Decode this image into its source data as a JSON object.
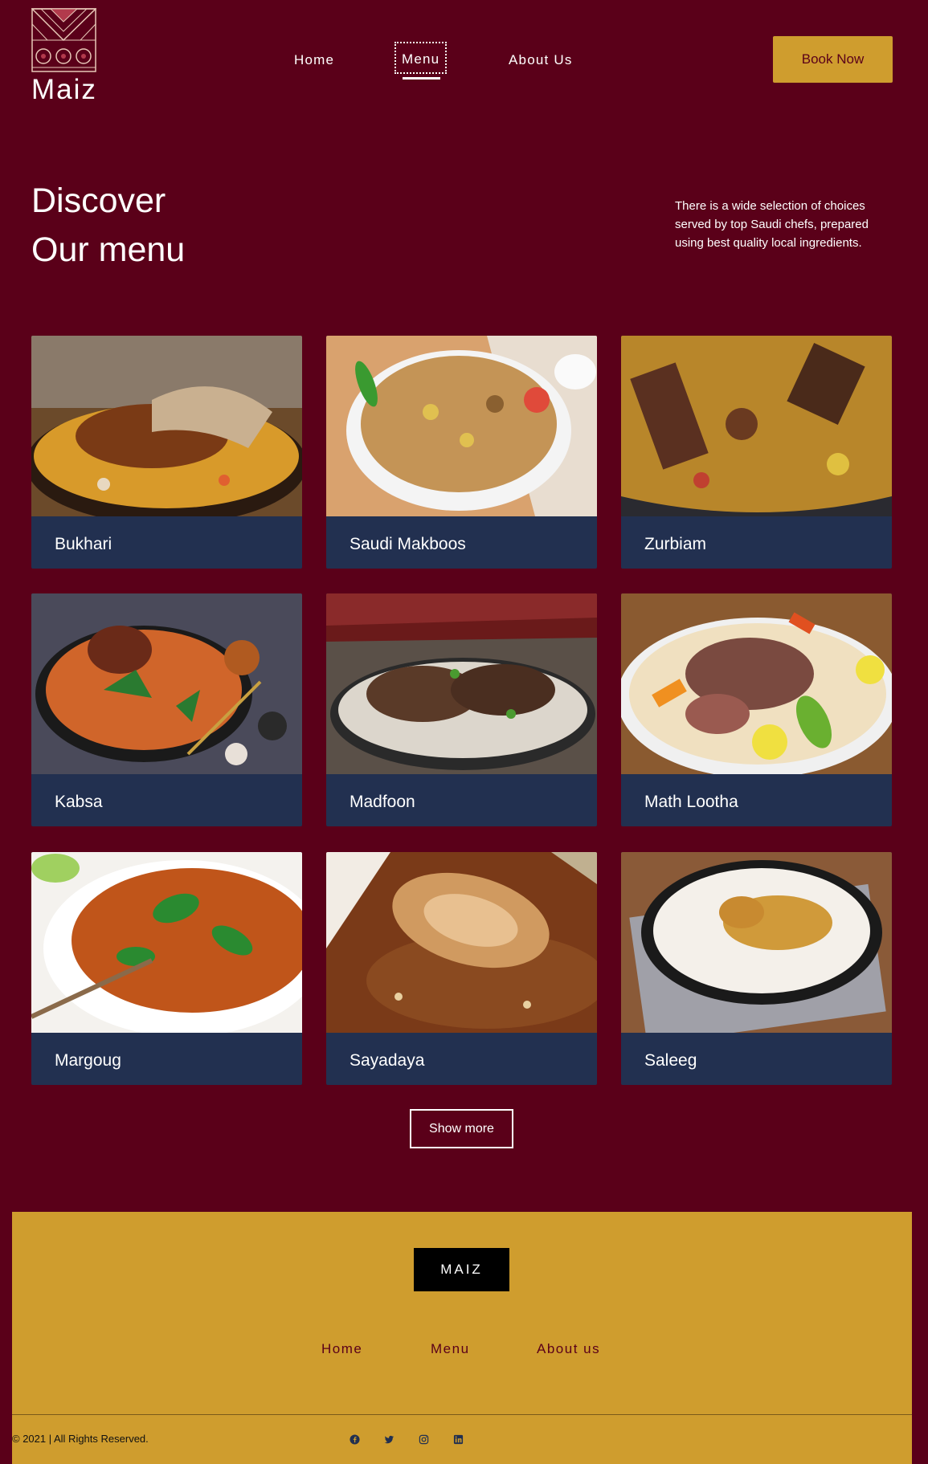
{
  "brand": {
    "name": "Maiz"
  },
  "nav": {
    "home": "Home",
    "menu": "Menu",
    "about": "About Us",
    "book": "Book Now"
  },
  "intro": {
    "title_line1": "Discover",
    "title_line2": "Our menu",
    "text": "There is a wide selection of choices served by top Saudi chefs, prepared using best quality local ingredients."
  },
  "menu": {
    "items": [
      {
        "name": "Bukhari"
      },
      {
        "name": "Saudi Makboos"
      },
      {
        "name": "Zurbiam"
      },
      {
        "name": "Kabsa"
      },
      {
        "name": "Madfoon"
      },
      {
        "name": "Math Lootha"
      },
      {
        "name": "Margoug"
      },
      {
        "name": "Sayadaya"
      },
      {
        "name": "Saleeg"
      }
    ],
    "show_more": "Show more"
  },
  "footer": {
    "logo": "MAIZ",
    "links": {
      "home": "Home",
      "menu": "Menu",
      "about": "About us"
    },
    "copyright": "© 2021 | All Rights Reserved.",
    "social_icons": [
      "facebook-icon",
      "twitter-icon",
      "instagram-icon",
      "linkedin-icon"
    ]
  },
  "colors": {
    "background": "#5a0019",
    "accent": "#cf9d2e",
    "card": "#223050"
  }
}
